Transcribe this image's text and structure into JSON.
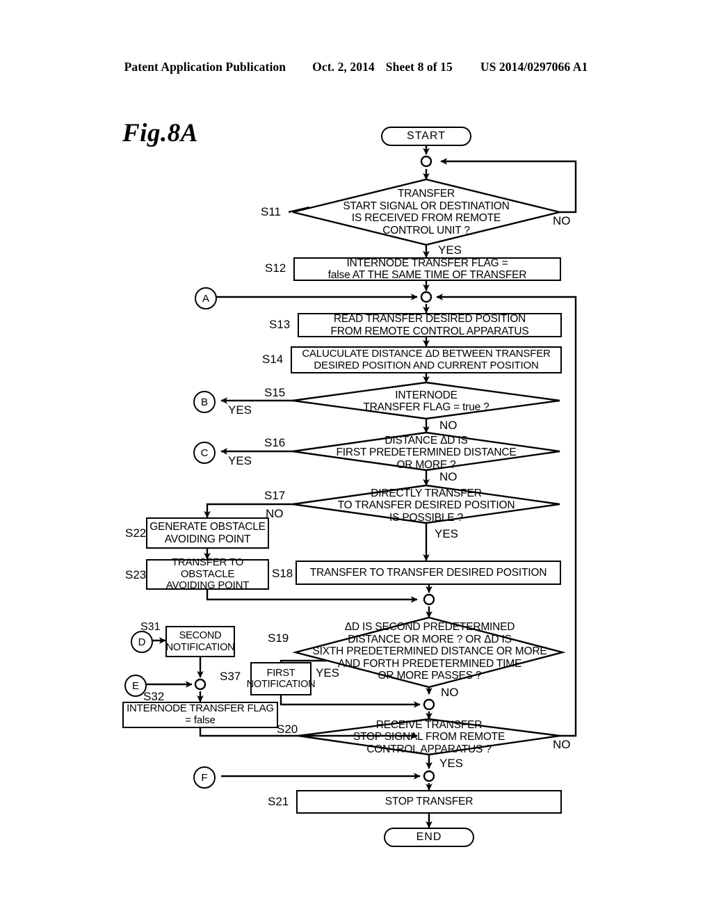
{
  "header": {
    "publication": "Patent Application Publication",
    "date": "Oct. 2, 2014",
    "sheet": "Sheet 8 of 15",
    "number": "US 2014/0297066 A1"
  },
  "figure": {
    "label": "Fig.8A"
  },
  "nodes": {
    "start": {
      "step": "",
      "text": "START"
    },
    "end": {
      "step": "",
      "text": "END"
    },
    "s11": {
      "step": "S11",
      "lines": [
        "TRANSFER",
        "START SIGNAL OR DESTINATION",
        "IS RECEIVED FROM REMOTE",
        "CONTROL UNIT ?"
      ],
      "yes": "YES",
      "no": "NO"
    },
    "s12": {
      "step": "S12",
      "lines": [
        "INTERNODE TRANSFER FLAG =",
        "false AT THE SAME TIME OF TRANSFER"
      ]
    },
    "s13": {
      "step": "S13",
      "lines": [
        "READ TRANSFER DESIRED POSITION",
        "FROM REMOTE CONTROL APPARATUS"
      ]
    },
    "s14": {
      "step": "S14",
      "lines": [
        "CALUCULATE DISTANCE ΔD BETWEEN TRANSFER",
        "DESIRED POSITION AND CURRENT POSITION"
      ]
    },
    "s15": {
      "step": "S15",
      "lines": [
        "INTERNODE",
        "TRANSFER FLAG = true ?"
      ],
      "yes": "YES",
      "no": "NO"
    },
    "s16": {
      "step": "S16",
      "lines": [
        "DISTANCE ΔD IS",
        "FIRST PREDETERMINED DISTANCE",
        "OR MORE ?"
      ],
      "yes": "YES",
      "no": "NO"
    },
    "s17": {
      "step": "S17",
      "lines": [
        "DIRECTLY TRANSFER",
        "TO TRANSFER DESIRED POSITION",
        "IS POSSIBLE ?"
      ],
      "yes": "YES",
      "no": "NO"
    },
    "s22": {
      "step": "S22",
      "lines": [
        "GENERATE OBSTACLE",
        "AVOIDING POINT"
      ]
    },
    "s23": {
      "step": "S23",
      "lines": [
        "TRANSFER TO OBSTACLE",
        "AVOIDING POINT"
      ]
    },
    "s18": {
      "step": "S18",
      "lines": [
        "TRANSFER TO TRANSFER DESIRED POSITION"
      ]
    },
    "s19": {
      "step": "S19",
      "lines": [
        "ΔD IS SECOND PREDETERMINED",
        "DISTANCE OR MORE ? OR ΔD IS",
        "SIXTH PREDETERMINED DISTANCE OR MORE",
        "AND FORTH PREDETERMINED TIME",
        "OR MORE PASSES ?"
      ],
      "yes": "YES",
      "no": "NO"
    },
    "s31": {
      "step": "S31",
      "lines": [
        "SECOND",
        "NOTIFICATION"
      ]
    },
    "s37": {
      "step": "S37",
      "lines": [
        "FIRST",
        "NOTIFICATION"
      ]
    },
    "s32": {
      "step": "S32",
      "lines": [
        "INTERNODE TRANSFER FLAG",
        "= false"
      ]
    },
    "s20": {
      "step": "S20",
      "lines": [
        "RECEIVE TRANSFER",
        "STOP SIGNAL FROM REMOTE",
        "CONTROL APPARATUS ?"
      ],
      "yes": "YES",
      "no": "NO"
    },
    "s21": {
      "step": "S21",
      "lines": [
        "STOP TRANSFER"
      ]
    }
  },
  "connectors": {
    "a": "A",
    "b": "B",
    "c": "C",
    "d": "D",
    "e": "E",
    "f": "F"
  },
  "colors": {
    "ink": "#000000",
    "paper": "#ffffff"
  }
}
